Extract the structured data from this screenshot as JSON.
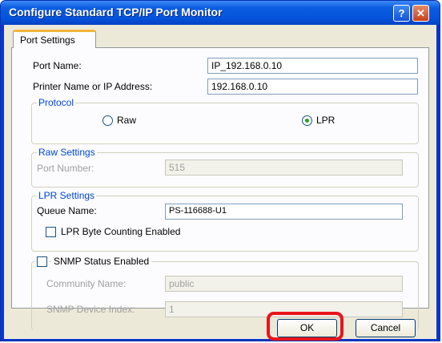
{
  "window": {
    "title": "Configure Standard TCP/IP Port Monitor",
    "help_glyph": "?",
    "close_glyph": "✕"
  },
  "tab": {
    "label": "Port Settings"
  },
  "fields": {
    "port_name_label": "Port Name:",
    "port_name_value": "IP_192.168.0.10",
    "printer_label": "Printer Name or IP Address:",
    "printer_value": "192.168.0.10"
  },
  "protocol": {
    "title": "Protocol",
    "raw_label": "Raw",
    "lpr_label": "LPR",
    "selected": "LPR"
  },
  "raw_settings": {
    "title": "Raw Settings",
    "port_number_label": "Port Number:",
    "port_number_value": "515"
  },
  "lpr_settings": {
    "title": "LPR Settings",
    "queue_name_label": "Queue Name:",
    "queue_name_value": "PS-116688-U1",
    "byte_counting_label": "LPR Byte Counting Enabled",
    "byte_counting_checked": false
  },
  "snmp": {
    "status_label": "SNMP Status Enabled",
    "status_checked": false,
    "community_label": "Community Name:",
    "community_value": "public",
    "device_index_label": "SNMP Device Index:",
    "device_index_value": "1"
  },
  "buttons": {
    "ok": "OK",
    "cancel": "Cancel"
  },
  "colors": {
    "titlebar": "#0654dd",
    "dialog_bg": "#ece9d8",
    "group_label": "#0046d5",
    "highlight": "#e8141c"
  }
}
